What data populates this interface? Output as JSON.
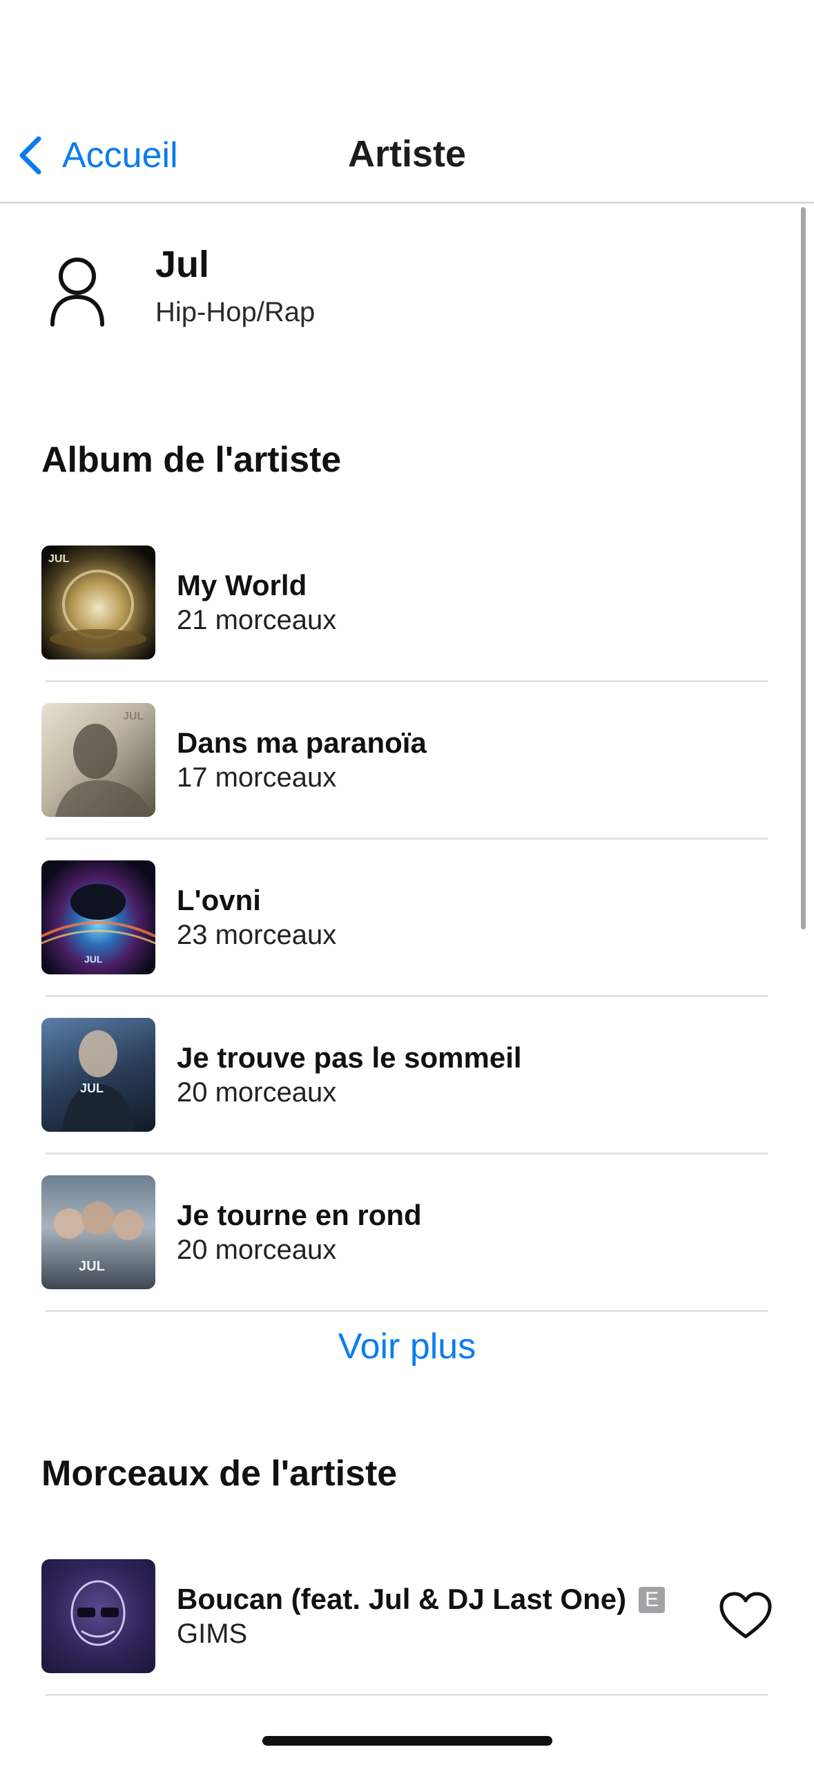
{
  "navbar": {
    "back_label": "Accueil",
    "title": "Artiste"
  },
  "artist": {
    "name": "Jul",
    "genre": "Hip-Hop/Rap"
  },
  "albums_section": {
    "title": "Album de l'artiste",
    "items": [
      {
        "title": "My World",
        "subtitle": "21 morceaux"
      },
      {
        "title": "Dans ma paranoïa",
        "subtitle": "17 morceaux"
      },
      {
        "title": "L'ovni",
        "subtitle": "23 morceaux"
      },
      {
        "title": "Je trouve pas le sommeil",
        "subtitle": "20 morceaux"
      },
      {
        "title": "Je tourne en rond",
        "subtitle": "20 morceaux"
      }
    ],
    "more_label": "Voir plus"
  },
  "tracks_section": {
    "title": "Morceaux de l'artiste",
    "items": [
      {
        "title": "Boucan (feat. Jul & DJ Last One)",
        "artist": "GIMS",
        "explicit_label": "E"
      }
    ]
  },
  "colors": {
    "accent": "#0a7cf0",
    "text": "#1c1c1e",
    "divider": "#e2e2e5"
  }
}
